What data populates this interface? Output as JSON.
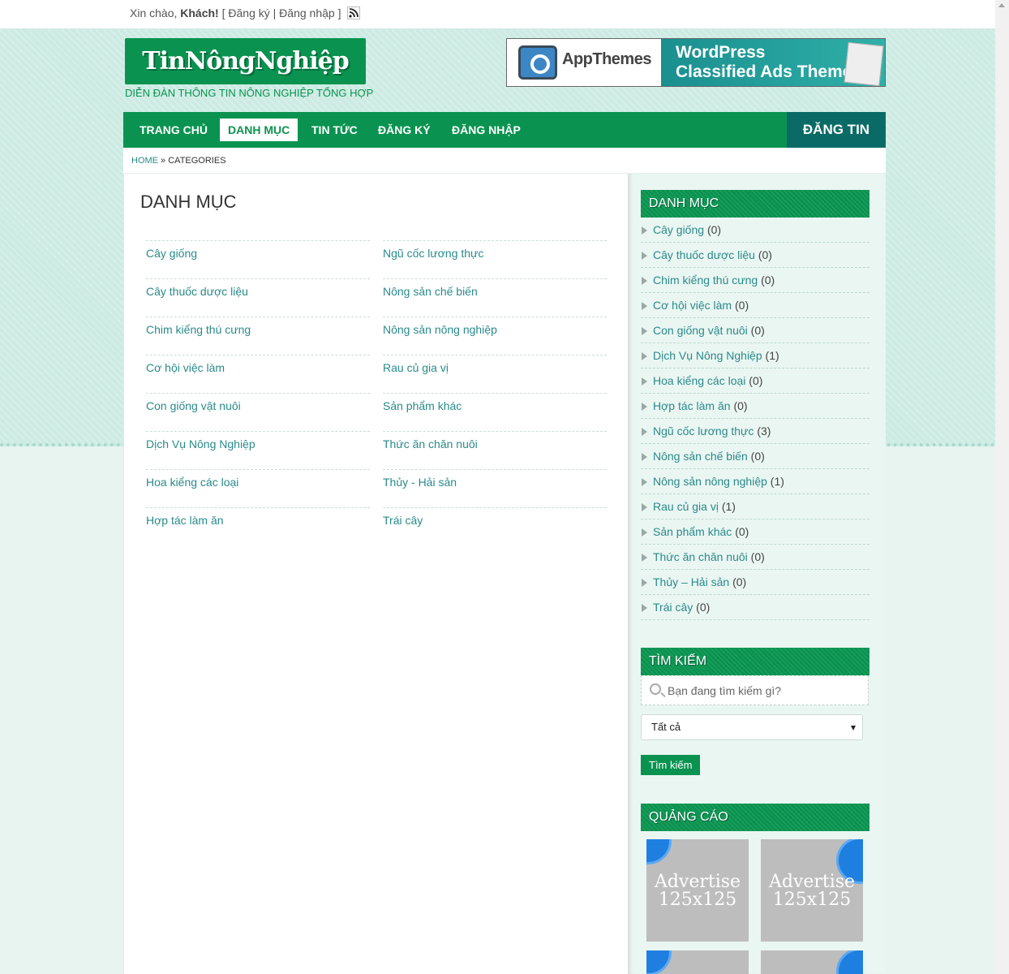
{
  "topbar": {
    "greeting_prefix": "Xin chào, ",
    "user": "Khách!",
    "open_bracket": " [ ",
    "register": "Đăng ký",
    "sep": " | ",
    "login": "Đăng nhập",
    "close_bracket": " ]"
  },
  "header": {
    "logo": "TinNôngNghiệp",
    "tagline": "DIỄN ĐÀN THÔNG TIN NÔNG NGHIỆP TỔNG HỢP",
    "banner_brand": "AppThemes",
    "banner_line1": "WordPress",
    "banner_line2": "Classified Ads Theme"
  },
  "nav": {
    "items": [
      "TRANG CHỦ",
      "DANH MỤC",
      "TIN TỨC",
      "ĐĂNG KÝ",
      "ĐĂNG NHẬP"
    ],
    "active": "DANH MỤC",
    "post_button": "ĐĂNG TIN"
  },
  "breadcrumb": {
    "home": "HOME",
    "sep": " » ",
    "current": "CATEGORIES"
  },
  "main": {
    "title": "DANH MỤC",
    "left_column": [
      "Cây giống",
      "Cây thuốc dược liệu",
      "Chim kiểng thú cưng",
      "Cơ hội việc làm",
      "Con giống vật nuôi",
      "Dịch Vụ Nông Nghiệp",
      "Hoa kiểng các loại",
      "Hợp tác làm ăn"
    ],
    "right_column": [
      "Ngũ cốc lương thực",
      "Nông sản chế biến",
      "Nông sản nông nghiệp",
      "Rau củ gia vị",
      "Sản phẩm khác",
      "Thức ăn chăn nuôi",
      "Thủy - Hải sản",
      "Trái cây"
    ]
  },
  "sidebar": {
    "categories_title": "DANH MỤC",
    "categories": [
      {
        "name": "Cây giống",
        "count": "(0)"
      },
      {
        "name": "Cây thuốc dược liệu",
        "count": "(0)"
      },
      {
        "name": "Chim kiểng thú cưng",
        "count": "(0)"
      },
      {
        "name": "Cơ hội việc làm",
        "count": "(0)"
      },
      {
        "name": "Con giống vật nuôi",
        "count": "(0)"
      },
      {
        "name": "Dịch Vụ Nông Nghiệp",
        "count": "(1)"
      },
      {
        "name": "Hoa kiểng các loại",
        "count": "(0)"
      },
      {
        "name": "Hợp tác làm ăn",
        "count": "(0)"
      },
      {
        "name": "Ngũ cốc lương thực",
        "count": "(3)"
      },
      {
        "name": "Nông sản chế biến",
        "count": "(0)"
      },
      {
        "name": "Nông sản nông nghiệp",
        "count": "(1)"
      },
      {
        "name": "Rau củ gia vị",
        "count": "(1)"
      },
      {
        "name": "Sản phẩm khác",
        "count": "(0)"
      },
      {
        "name": "Thức ăn chăn nuôi",
        "count": "(0)"
      },
      {
        "name": "Thủy – Hải sản",
        "count": "(0)"
      },
      {
        "name": "Trái cây",
        "count": "(0)"
      }
    ],
    "search_title": "TÌM KIẾM",
    "search_placeholder": "Bạn đang tìm kiếm gì?",
    "select_value": "Tất cả",
    "search_button": "Tìm kiếm",
    "ads_title": "QUẢNG CÁO",
    "ad_line1": "Advertise",
    "ad_line2": "125x125"
  },
  "colors": {
    "brand_green": "#0a9350",
    "post_button": "#0a6b66",
    "link_teal": "#2a8a8a"
  }
}
